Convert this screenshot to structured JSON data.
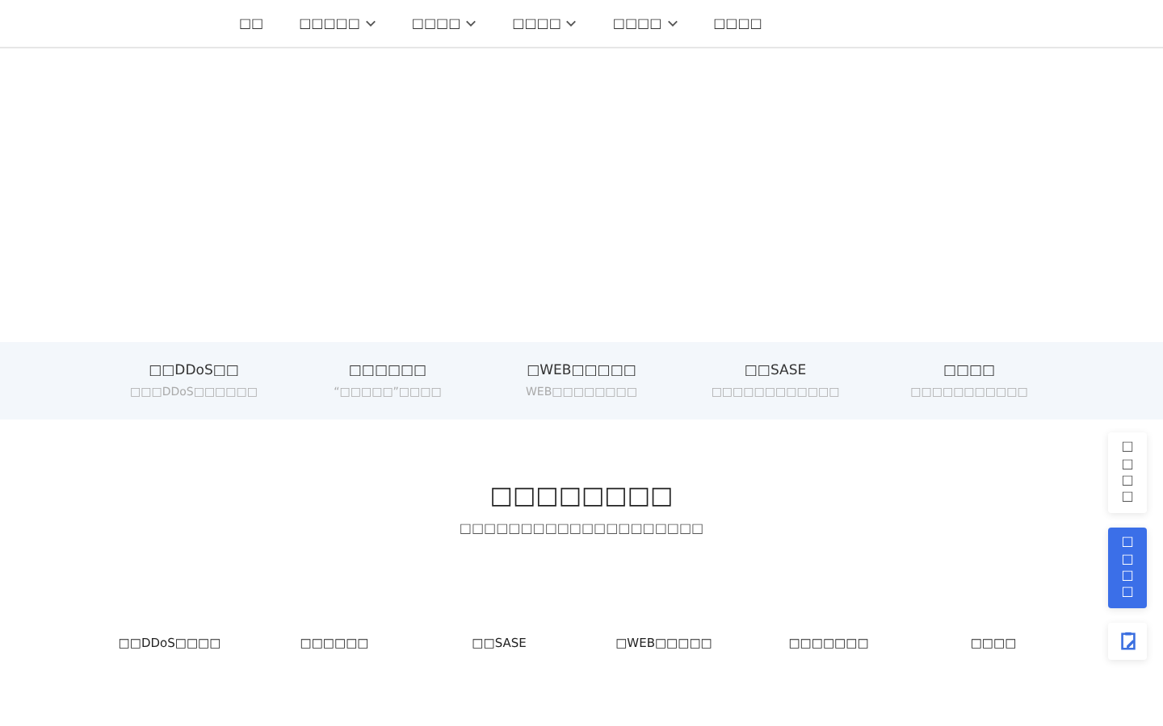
{
  "nav": [
    {
      "label": "□□",
      "dropdown": false
    },
    {
      "label": "□□□□□",
      "dropdown": true
    },
    {
      "label": "□□□□",
      "dropdown": true
    },
    {
      "label": "□□□□",
      "dropdown": true
    },
    {
      "label": "□□□□",
      "dropdown": true
    },
    {
      "label": "□□□□",
      "dropdown": false
    }
  ],
  "features": [
    {
      "title": "□□DDoS□□",
      "subtitle": "□□□DDoS□□□□□□"
    },
    {
      "title": "□□□□□□",
      "subtitle": "“□□□□□”□□□□"
    },
    {
      "title": "□WEB□□□□□",
      "subtitle": "WEB□□□□□□□□"
    },
    {
      "title": "□□SASE",
      "subtitle": "□□□□□□□□□□□□"
    },
    {
      "title": "□□□□",
      "subtitle": "□□□□□□□□□□□"
    }
  ],
  "section": {
    "heading": "□□□□□□□□",
    "subheading": "□□□□□□□□□□□□□□□□□□□□"
  },
  "tabs": [
    "□□DDoS□□□□",
    "□□□□□□",
    "□□SASE",
    "□WEB□□□□□",
    "□□□□□□□",
    "□□□□"
  ],
  "side_buttons": [
    {
      "kind": "text",
      "label": "□□□□",
      "highlighted": false
    },
    {
      "kind": "text",
      "label": "□□□□",
      "highlighted": true
    },
    {
      "kind": "icon",
      "highlighted": false
    }
  ]
}
